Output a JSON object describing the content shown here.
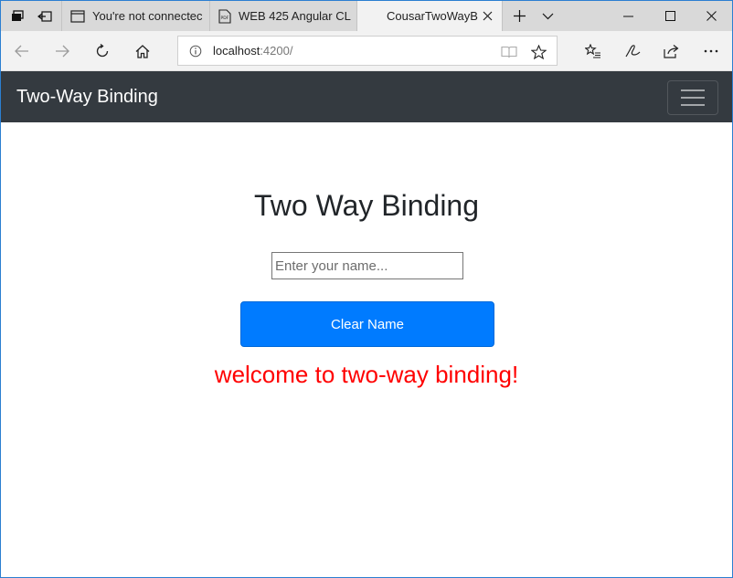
{
  "browser": {
    "tabs": [
      {
        "title": "You're not connectec",
        "icon": "page-icon"
      },
      {
        "title": "WEB 425 Angular CL",
        "icon": "pdf-icon"
      },
      {
        "title": "CousarTwoWayB",
        "icon": "none",
        "active": true
      }
    ],
    "address": {
      "host": "localhost",
      "port_path": ":4200/"
    }
  },
  "navbar": {
    "brand": "Two-Way Binding"
  },
  "page": {
    "heading": "Two Way Binding",
    "name_input": {
      "value": "",
      "placeholder": "Enter your name..."
    },
    "clear_button": "Clear Name",
    "welcome_message": "welcome to two-way binding!"
  },
  "colors": {
    "navbar_bg": "#343a40",
    "button_primary": "#007bff",
    "welcome_text": "#ff0000"
  }
}
